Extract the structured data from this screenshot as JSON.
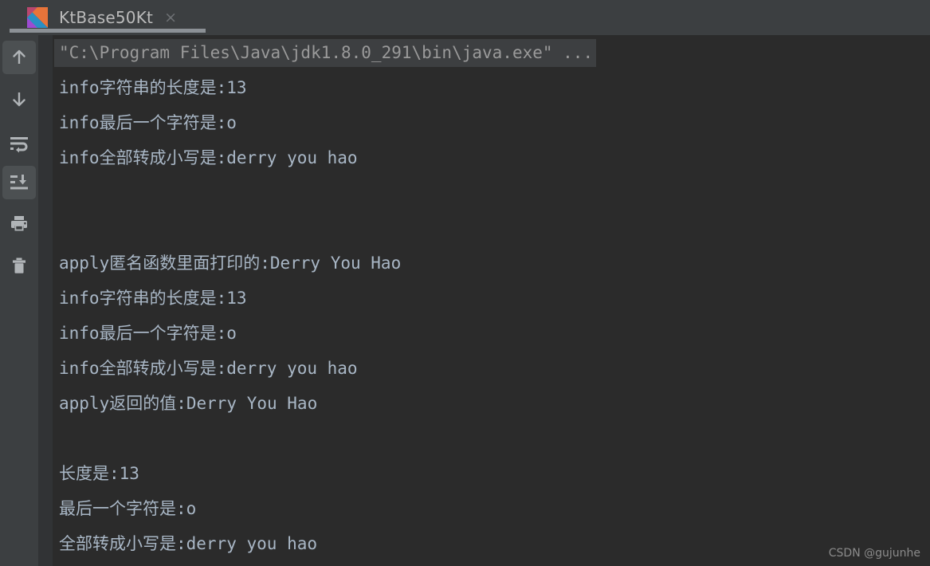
{
  "window": {
    "background": "#2b2b2b",
    "tabbar_background": "#3c3f41"
  },
  "tab": {
    "title": "KtBase50Kt",
    "close_label": "×",
    "icon": "kotlin-icon",
    "active": true,
    "underline_color": "#8c9196"
  },
  "toolbar": {
    "items": [
      {
        "name": "rerun-up-arrow",
        "icon": "arrow-up-icon",
        "active": true
      },
      {
        "name": "scroll-down-arrow",
        "icon": "arrow-down-icon",
        "active": false
      },
      {
        "name": "soft-wrap",
        "icon": "soft-wrap-icon",
        "active": false
      },
      {
        "name": "scroll-to-end",
        "icon": "scroll-to-end-icon",
        "active": true
      },
      {
        "name": "print",
        "icon": "printer-icon",
        "active": false
      },
      {
        "name": "clear-all",
        "icon": "trash-icon",
        "active": false
      }
    ]
  },
  "console": {
    "background": "#2b2b2b",
    "gutter_color": "#313335",
    "command_line": "\"C:\\Program Files\\Java\\jdk1.8.0_291\\bin\\java.exe\" ...",
    "lines": [
      {
        "type": "command",
        "text": "\"C:\\Program Files\\Java\\jdk1.8.0_291\\bin\\java.exe\" ..."
      },
      {
        "type": "output",
        "text": "info字符串的长度是:13"
      },
      {
        "type": "output",
        "text": "info最后一个字符是:o"
      },
      {
        "type": "output",
        "text": "info全部转成小写是:derry you hao"
      },
      {
        "type": "blank",
        "text": ""
      },
      {
        "type": "blank",
        "text": ""
      },
      {
        "type": "output",
        "text": "apply匿名函数里面打印的:Derry You Hao"
      },
      {
        "type": "output",
        "text": "info字符串的长度是:13"
      },
      {
        "type": "output",
        "text": "info最后一个字符是:o"
      },
      {
        "type": "output",
        "text": "info全部转成小写是:derry you hao"
      },
      {
        "type": "output",
        "text": "apply返回的值:Derry You Hao"
      },
      {
        "type": "blank",
        "text": ""
      },
      {
        "type": "blank",
        "text": ""
      },
      {
        "type": "output",
        "text": "长度是:13"
      },
      {
        "type": "output",
        "text": "最后一个字符是:o"
      },
      {
        "type": "output",
        "text": "全部转成小写是:derry you hao"
      }
    ]
  },
  "watermark": {
    "text": "CSDN @gujunhe"
  }
}
